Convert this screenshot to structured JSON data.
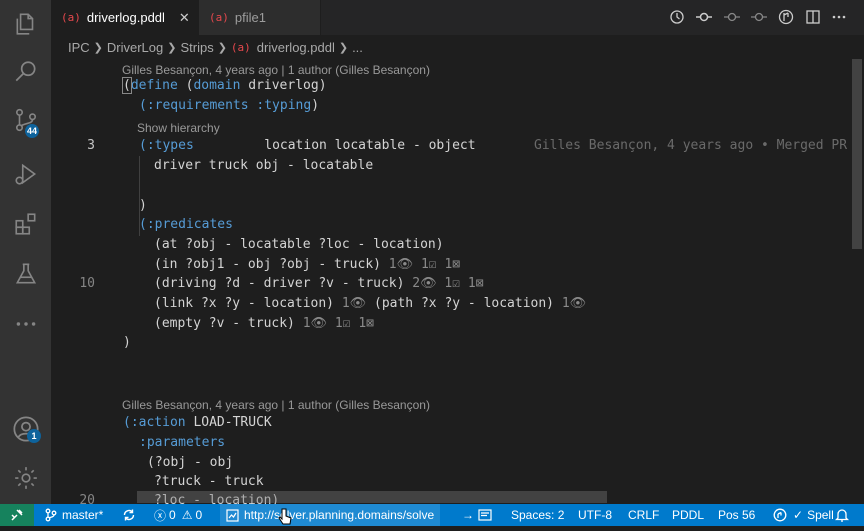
{
  "activity": {
    "scm_badge": "44",
    "accounts_badge": "1"
  },
  "tabs": [
    {
      "icon_text": "(a)",
      "label": "driverlog.pddl",
      "close": "✕"
    },
    {
      "icon_text": "(a)",
      "label": "pfile1"
    }
  ],
  "breadcrumb": {
    "items": [
      "IPC",
      "DriverLog",
      "Strips"
    ],
    "file_icon": "(a)",
    "file": "driverlog.pddl",
    "more": "..."
  },
  "editor": {
    "lens1": "Gilles Besançon, 4 years ago | 1 author (Gilles Besançon)",
    "lens2": "Show hierarchy",
    "lens3": "Gilles Besançon, 4 years ago | 1 author (Gilles Besançon)",
    "line_numbers": {
      "a": "3",
      "b": "10",
      "c": "20"
    },
    "blame": "Gilles Besançon, 4 years ago • Merged PR",
    "lines": {
      "l1_open": "(",
      "l1_kw": "define",
      "l1_mid": " (",
      "l1_kw2": "domain",
      "l1_rest": " driverlog)",
      "l2_kw": "(:requirements :typing",
      "l2_rest": ")",
      "l3_kw": "(:types",
      "l3_rest": "         location locatable - object",
      "l4": "driver truck obj - locatable",
      "l6": ")",
      "l7_kw": "(:predicates",
      "l8": "(at ?obj - locatable ?loc - location)",
      "l9": "(in ?obj1 - obj ?obj - truck)",
      "l9_hint": " 1👁 1☑ 1⊠",
      "l10": "(driving ?d - driver ?v - truck)",
      "l10_hint": " 2👁 1☑ 1⊠",
      "l11a": "(link ?x ?y - location)",
      "l11a_hint": " 1👁 ",
      "l11b": "(path ?x ?y - location)",
      "l11b_hint": " 1👁",
      "l12": "(empty ?v - truck)",
      "l12_hint": " 1👁 1☑ 1⊠",
      "l13": ")",
      "l14_kw": "(:action",
      "l14_rest": " LOAD-TRUCK",
      "l15_kw": ":parameters",
      "l16": "(?obj - obj",
      "l17": "?truck - truck",
      "l18": "?loc - location)"
    }
  },
  "status": {
    "branch": "master*",
    "errors": "0",
    "warnings": "0",
    "url": "http://solver.planning.domains/solve",
    "spaces": "Spaces: 2",
    "encoding": "UTF-8",
    "eol": "CRLF",
    "language": "PDDL",
    "position": "Pos 56",
    "spell": "Spell"
  }
}
